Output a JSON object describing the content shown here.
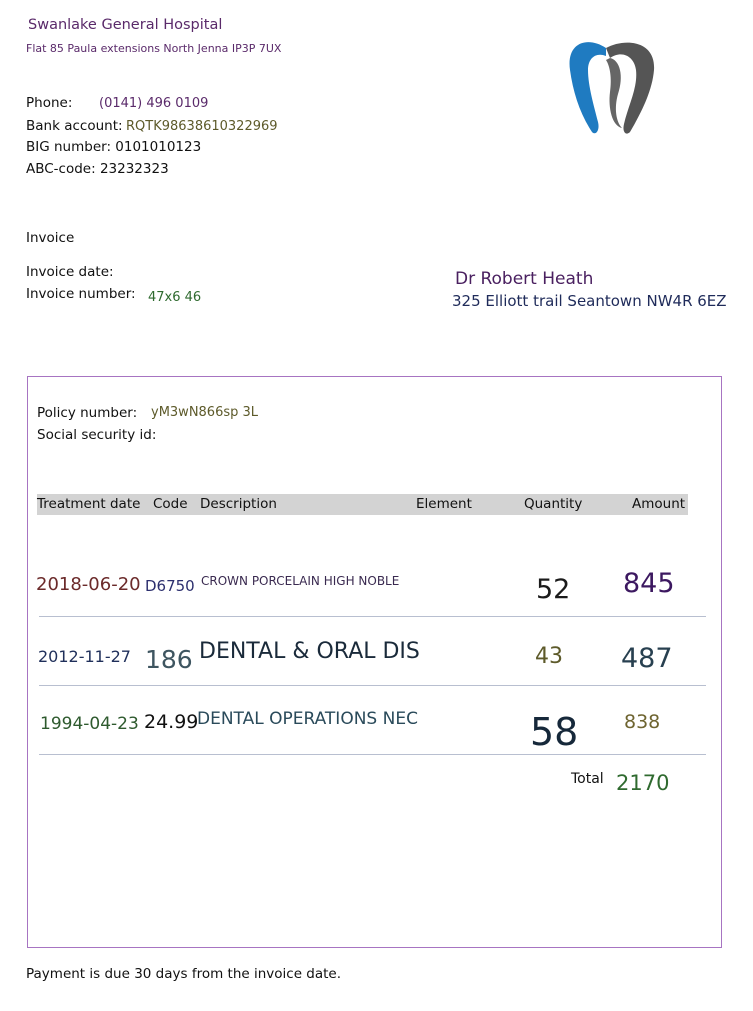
{
  "hospital": {
    "name": "Swanlake General Hospital",
    "address": "Flat 85 Paula extensions North Jenna IP3P 7UX"
  },
  "contact": {
    "phone_label": "Phone:",
    "phone_value": "(0141) 496 0109",
    "bank_label": "Bank account:",
    "bank_value": "RQTK98638610322969",
    "big_text": "BIG number: 0101010123",
    "abc_text": "ABC-code: 23232323"
  },
  "invoice": {
    "heading": "Invoice",
    "date_label": "Invoice date:",
    "number_label": "Invoice number:",
    "number_value": "47x6 46"
  },
  "recipient": {
    "name": "Dr Robert Heath",
    "address": "325 Elliott trail Seantown NW4R 6EZ"
  },
  "policy": {
    "policy_label": "Policy number:",
    "policy_value": "yM3wN866sp 3L",
    "ssid_label": "Social security id:"
  },
  "table": {
    "headers": {
      "date": "Treatment date",
      "code": "Code",
      "description": "Description",
      "element": "Element",
      "quantity": "Quantity",
      "amount": "Amount"
    },
    "rows": [
      {
        "date": "2018-06-20",
        "code": "D6750",
        "description": "CROWN PORCELAIN HIGH NOBLE",
        "quantity": "52",
        "amount": "845"
      },
      {
        "date": "2012-11-27",
        "code": "186",
        "description": "DENTAL & ORAL DIS",
        "quantity": "43",
        "amount": "487"
      },
      {
        "date": "1994-04-23",
        "code": "24.99",
        "description": "DENTAL OPERATIONS NEC",
        "quantity": "58",
        "amount": "838"
      }
    ],
    "total_label": "Total",
    "total_value": "2170"
  },
  "footer": {
    "text": "Payment is due 30 days from the invoice date."
  },
  "logo": {
    "icon": "tooth-icon",
    "colors": {
      "blue": "#1f7bc1",
      "gray": "#555555"
    }
  }
}
